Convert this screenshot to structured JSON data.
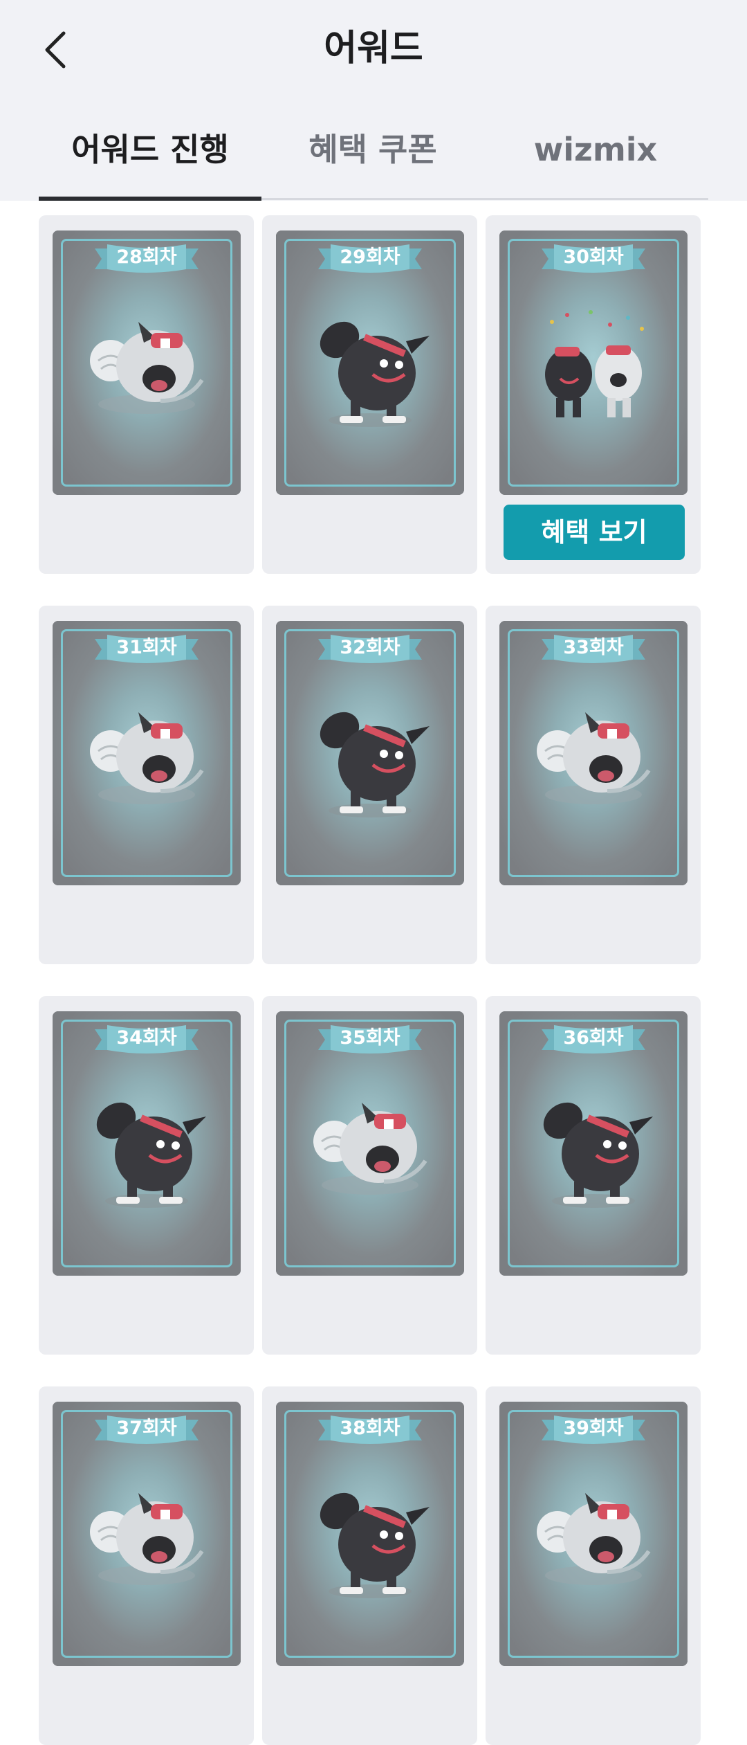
{
  "header": {
    "title": "어워드",
    "back_icon": "chevron-left-icon"
  },
  "tabs": [
    {
      "label": "어워드 진행",
      "active": true
    },
    {
      "label": "혜택 쿠폰",
      "active": false
    },
    {
      "label": "wizmix",
      "active": false
    }
  ],
  "cards": [
    {
      "label": "28회차",
      "mascot": "white-mascot-icon",
      "has_button": false
    },
    {
      "label": "29회차",
      "mascot": "black-mascot-icon",
      "has_button": false
    },
    {
      "label": "30회차",
      "mascot": "duo-mascot-icon",
      "has_button": true
    },
    {
      "label": "31회차",
      "mascot": "white-mascot-icon",
      "has_button": false
    },
    {
      "label": "32회차",
      "mascot": "black-mascot-icon",
      "has_button": false
    },
    {
      "label": "33회차",
      "mascot": "white-mascot-icon",
      "has_button": false
    },
    {
      "label": "34회차",
      "mascot": "black-mascot-icon",
      "has_button": false
    },
    {
      "label": "35회차",
      "mascot": "white-mascot-icon",
      "has_button": false
    },
    {
      "label": "36회차",
      "mascot": "black-mascot-icon",
      "has_button": false
    },
    {
      "label": "37회차",
      "mascot": "white-mascot-icon",
      "has_button": false
    },
    {
      "label": "38회차",
      "mascot": "black-mascot-icon",
      "has_button": false
    },
    {
      "label": "39회차",
      "mascot": "white-mascot-icon",
      "has_button": false
    }
  ],
  "benefit_button_label": "혜택 보기",
  "colors": {
    "accent": "#139cad",
    "card_frame": "#7cc5cf",
    "background": "#f1f2f6"
  }
}
